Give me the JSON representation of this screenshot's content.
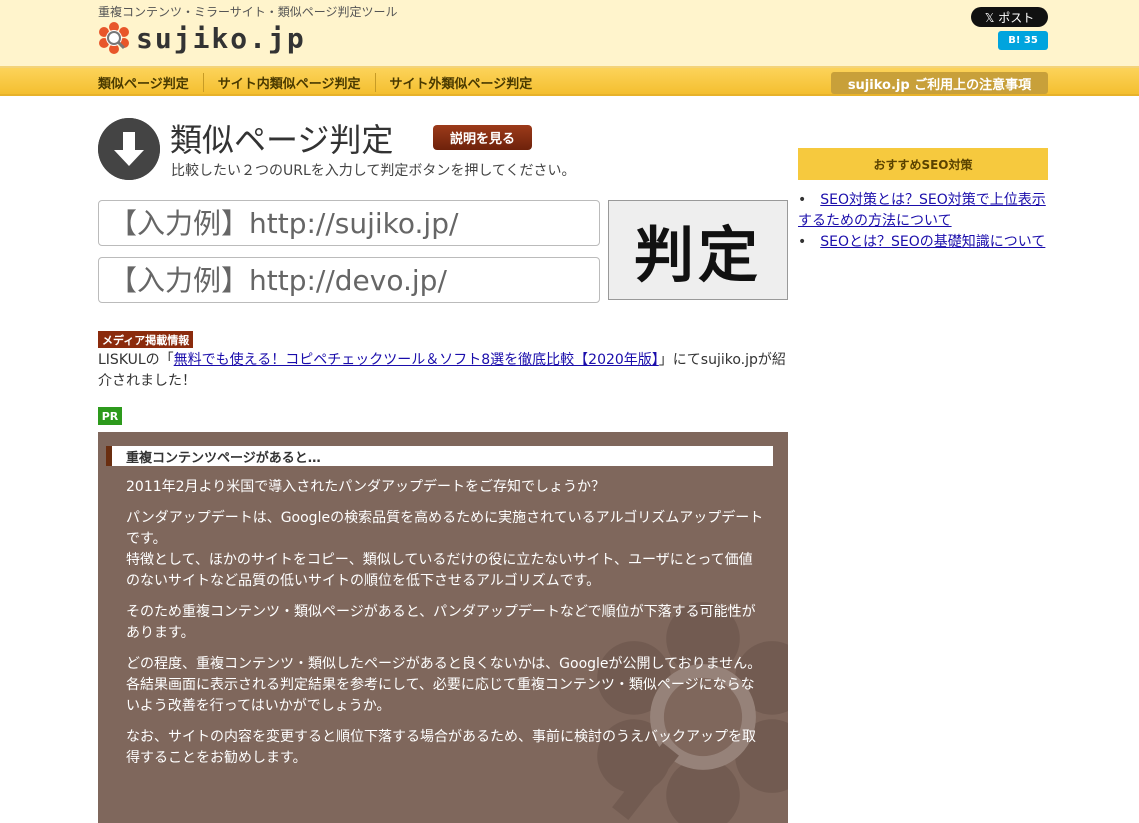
{
  "header": {
    "tagline": "重複コンテンツ・ミラーサイト・類似ページ判定ツール",
    "logo_text": "sujiko.jp",
    "post_label": "𝕏 ポスト",
    "hatena_label": "B! 35"
  },
  "nav": {
    "items": [
      "類似ページ判定",
      "サイト内類似ページ判定",
      "サイト外類似ページ判定"
    ],
    "notice": "sujiko.jp ご利用上の注意事項"
  },
  "main": {
    "title": "類似ページ判定",
    "explain_button": "説明を見る",
    "subtitle": "比較したい２つのURLを入力して判定ボタンを押してください。",
    "url1_placeholder": "【入力例】http://sujiko.jp/",
    "url2_placeholder": "【入力例】http://devo.jp/",
    "judge_button": "判定"
  },
  "media": {
    "badge": "メディア掲載情報",
    "prefix": "LISKULの「",
    "link_text": "無料でも使える！コピペチェックツール＆ソフト8選を徹底比較【2020年版】",
    "suffix": "」にてsujiko.jpが紹介されました！"
  },
  "pr_badge": "PR",
  "info": {
    "heading": "重複コンテンツページがあると…",
    "paragraphs": [
      "2011年2月より米国で導入されたパンダアップデートをご存知でしょうか？",
      "パンダアップデートは、Googleの検索品質を高めるために実施されているアルゴリズムアップデートです。",
      "特徴として、ほかのサイトをコピー、類似しているだけの役に立たないサイト、ユーザにとって価値のないサイトなど品質の低いサイトの順位を低下させるアルゴリズムです。",
      "そのため重複コンテンツ・類似ページがあると、パンダアップデートなどで順位が下落する可能性があります。",
      "どの程度、重複コンテンツ・類似したページがあると良くないかは、Googleが公開しておりません。",
      "各結果画面に表示される判定結果を参考にして、必要に応じて重複コンテンツ・類似ページにならないよう改善を行ってはいかがでしょうか。",
      "なお、サイトの内容を変更すると順位下落する場合があるため、事前に検討のうえバックアップを取得することをお勧めします。"
    ]
  },
  "sidebar": {
    "heading": "おすすめSEO対策",
    "links": [
      "SEO対策とは？SEO対策で上位表示するための方法について",
      "SEOとは？SEOの基礎知識について"
    ]
  },
  "colors": {
    "header_bg": "#fff4cc",
    "nav_bg": "#f4bf30",
    "info_bg": "#7f675c",
    "accent_brown": "#8b2b0d",
    "link": "#1a0dab"
  },
  "icons": {
    "logo": "flower-magnifier-icon",
    "title": "down-arrow-circle-icon"
  }
}
